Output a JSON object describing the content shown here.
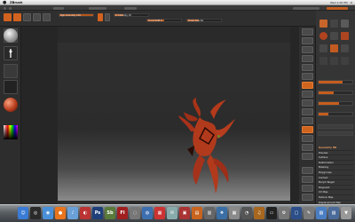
{
  "menubar": {
    "app_name": "ZBrush",
    "status_items": [
      "Wed 1:00 PM",
      "Q"
    ]
  },
  "toolbar": {
    "sliders": [
      {
        "label": "Rgb Intensity 100",
        "fill": 1.0
      },
      {
        "label": "Z Intensity 25",
        "fill": 0.25
      },
      {
        "label": "Focal Shift 0",
        "fill": 0.5
      },
      {
        "label": "Draw Size 64",
        "fill": 0.35
      }
    ]
  },
  "tray": {
    "title": "Tool",
    "list": [
      {
        "label": "Geometry HD"
      },
      {
        "label": "Preview"
      },
      {
        "label": "Surface"
      },
      {
        "label": "Deformation"
      },
      {
        "label": "Masking"
      },
      {
        "label": "Polygroups"
      },
      {
        "label": "Contact"
      },
      {
        "label": "Morph Target"
      },
      {
        "label": "Polypaint"
      },
      {
        "label": "UV Map"
      },
      {
        "label": "Texture Map"
      },
      {
        "label": "Displacement Map"
      },
      {
        "label": "Normal Map"
      },
      {
        "label": "Vector Displacement"
      },
      {
        "label": "Display Properties"
      },
      {
        "label": "Unified Skin"
      },
      {
        "label": "Import"
      }
    ],
    "sliders": [
      0.7,
      0.45,
      0.6,
      0.3
    ]
  },
  "dock": {
    "icons": [
      {
        "name": "finder-icon",
        "glyph": "☺",
        "color": "#3a7bd5"
      },
      {
        "name": "dashboard-icon",
        "glyph": "◎",
        "color": "#2a2a2a"
      },
      {
        "name": "safari-icon",
        "glyph": "◉",
        "color": "#4a90d9"
      },
      {
        "name": "firefox-icon",
        "glyph": "●",
        "color": "#e8741c"
      },
      {
        "name": "itunes-icon",
        "glyph": "♪",
        "color": "#6aa0d8"
      },
      {
        "name": "app-icon",
        "glyph": "◐",
        "color": "#b33"
      },
      {
        "name": "photoshop-icon",
        "glyph": "Ps",
        "color": "#1f3f7a"
      },
      {
        "name": "soundbooth-icon",
        "glyph": "Sb",
        "color": "#5a7a3a"
      },
      {
        "name": "flash-icon",
        "glyph": "Fl",
        "color": "#a01f1f"
      },
      {
        "name": "disc-icon",
        "glyph": "◌",
        "color": "#777"
      },
      {
        "name": "globe-icon",
        "glyph": "◍",
        "color": "#3d6fb0"
      },
      {
        "name": "calendar-icon",
        "glyph": "▦",
        "color": "#c33"
      },
      {
        "name": "mail-icon",
        "glyph": "✉",
        "color": "#8aa"
      },
      {
        "name": "app2-icon",
        "glyph": "▣",
        "color": "#a33"
      },
      {
        "name": "app3-icon",
        "glyph": "▤",
        "color": "#c8641e"
      },
      {
        "name": "preview-icon",
        "glyph": "▥",
        "color": "#666"
      },
      {
        "name": "photos-icon",
        "glyph": "❖",
        "color": "#3a6ea5"
      },
      {
        "name": "grid-icon",
        "glyph": "▦",
        "color": "#8a8a8a"
      },
      {
        "name": "speaker-icon",
        "glyph": "◔",
        "color": "#555"
      },
      {
        "name": "guitar-icon",
        "glyph": "♫",
        "color": "#a8671e"
      },
      {
        "name": "terminal-icon",
        "glyph": "▭",
        "color": "#222"
      },
      {
        "name": "settings-icon",
        "glyph": "⚙",
        "color": "#777"
      },
      {
        "name": "screen-icon",
        "glyph": "▢",
        "color": "#2c4f8a"
      },
      {
        "name": "tool-icon",
        "glyph": "✎",
        "color": "#7a7a7a"
      },
      {
        "name": "folder-icon",
        "glyph": "▧",
        "color": "#4a7ec2"
      },
      {
        "name": "stack-icon",
        "glyph": "▨",
        "color": "#4a6a9a"
      },
      {
        "name": "trash-icon",
        "glyph": "▼",
        "color": "#999"
      }
    ]
  }
}
